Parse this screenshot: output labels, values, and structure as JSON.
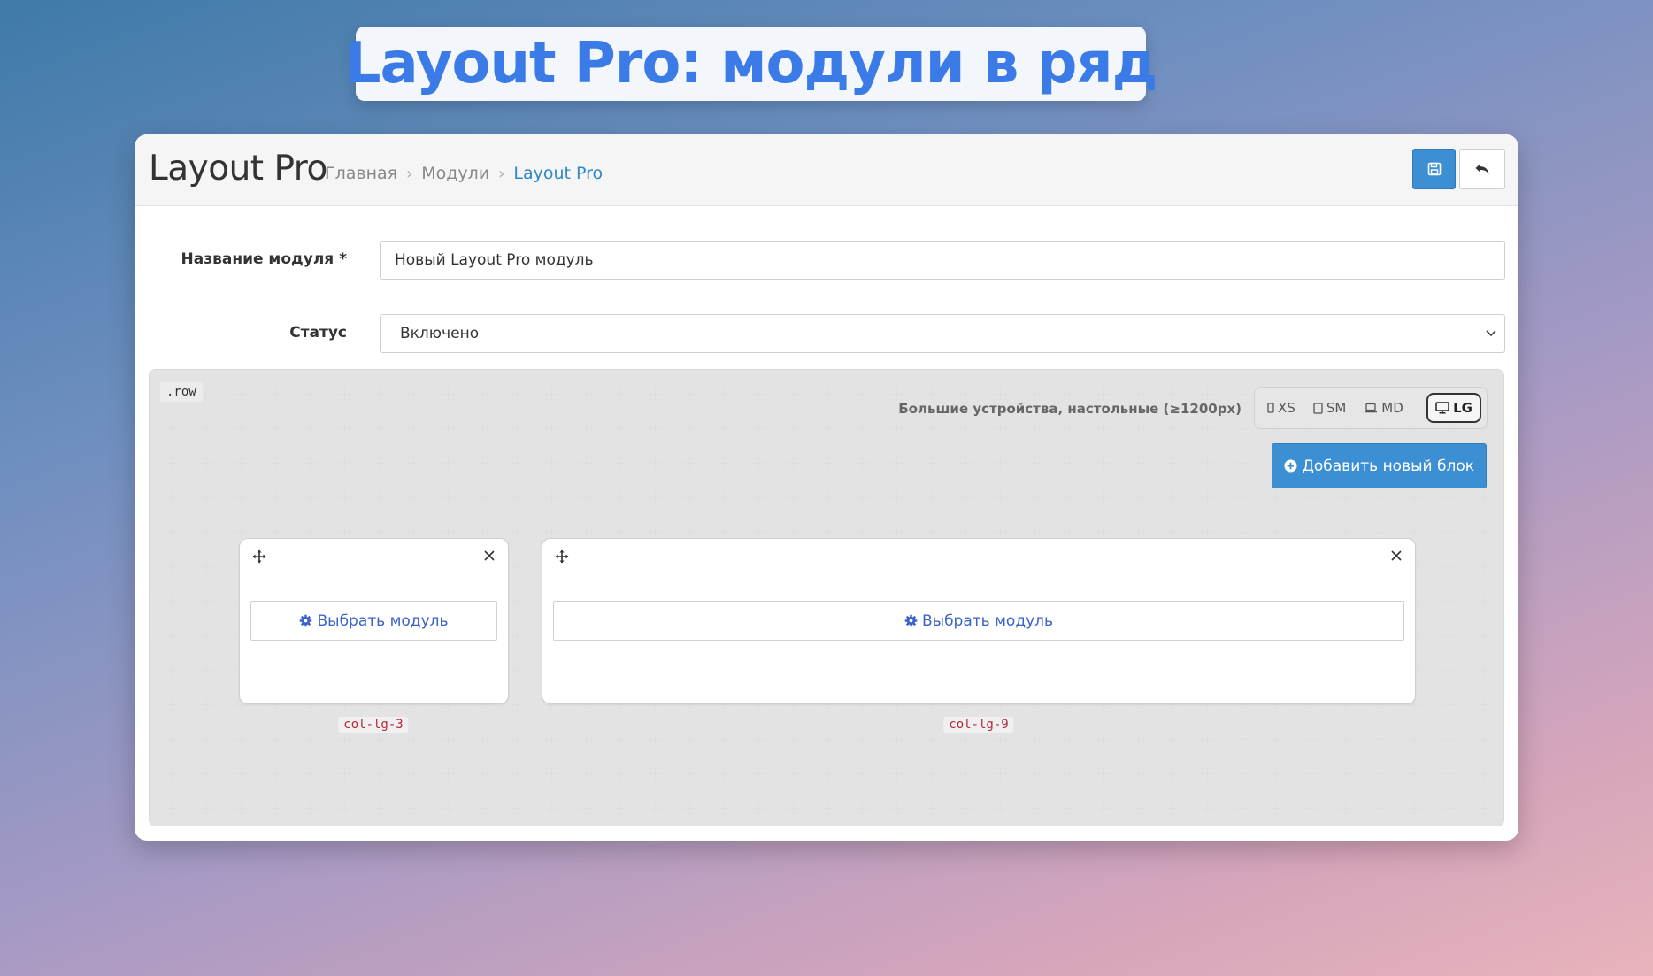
{
  "hero": {
    "title": "Layout Pro: модули в ряд"
  },
  "header": {
    "page_title": "Layout Pro",
    "breadcrumb": [
      "Главная",
      "Модули",
      "Layout Pro"
    ]
  },
  "toolbar": {
    "save_icon": "floppy-disk-icon",
    "back_icon": "reply-arrow-icon"
  },
  "form": {
    "name_label": "Название модуля *",
    "name_value": "Новый Layout Pro модуль",
    "status_label": "Статус",
    "status_value": "Включено"
  },
  "builder": {
    "row_tag": ".row",
    "device_caption": "Большие устройства, настольные (≥1200px)",
    "devices": [
      {
        "label": "XS",
        "icon": "phone-icon",
        "active": false
      },
      {
        "label": "SM",
        "icon": "tablet-icon",
        "active": false
      },
      {
        "label": "MD",
        "icon": "laptop-icon",
        "active": false
      },
      {
        "label": "LG",
        "icon": "desktop-icon",
        "active": true
      }
    ],
    "add_block_label": "Добавить новый блок",
    "columns": [
      {
        "choose_label": "Выбрать модуль",
        "class_label": "col-lg-3",
        "span": 3
      },
      {
        "choose_label": "Выбрать модуль",
        "class_label": "col-lg-9",
        "span": 9
      }
    ]
  },
  "colors": {
    "hero_text": "#3b7be8",
    "primary": "#3d8fd3",
    "breadcrumb_active": "#2f87c7",
    "choose_text": "#3a62c9",
    "col_label_text": "#b5283a"
  }
}
